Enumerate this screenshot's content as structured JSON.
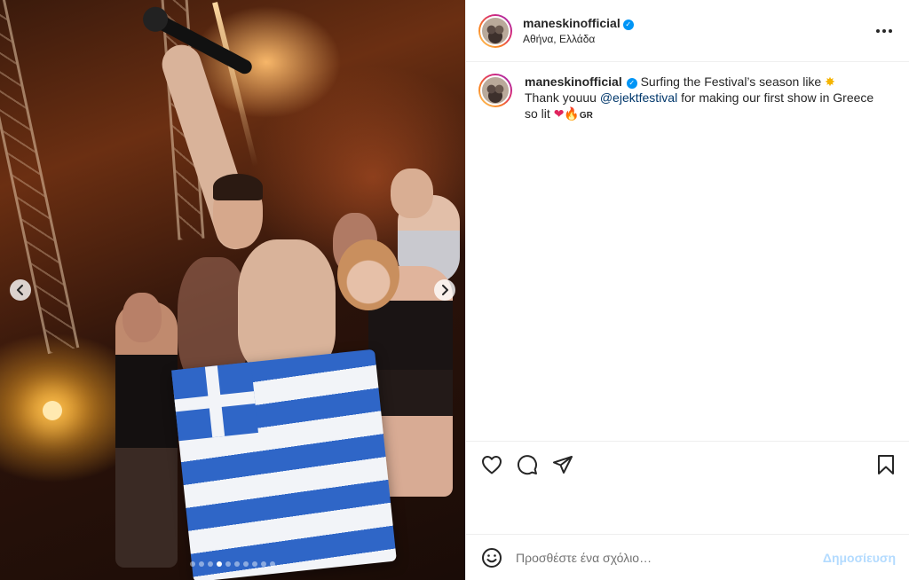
{
  "post": {
    "username": "maneskinofficial",
    "location": "Αθήνα, Ελλάδα",
    "more_label": "•••",
    "caption": {
      "line1": "Surfing the Festival’s season like",
      "line2_pre": "Thank youuu",
      "mention": "@ejektfestival",
      "line2_post": "for making our first show in Greece",
      "line3": "so lit",
      "emoji_star": "✸",
      "emoji_heart": "❤",
      "emoji_fire": "🔥",
      "flag_text": "GR"
    }
  },
  "carousel": {
    "prev_label": "‹",
    "next_label": "›",
    "slide_count": 10,
    "active_index": 3
  },
  "comment": {
    "placeholder": "Προσθέστε ένα σχόλιο…",
    "post_label": "Δημοσίευση"
  },
  "icons": {
    "verified": "✓"
  }
}
